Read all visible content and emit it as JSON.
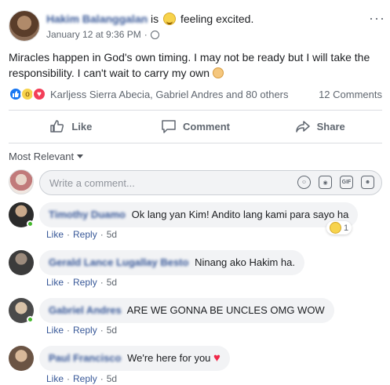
{
  "post": {
    "author": "Hakim Balanggalan",
    "verb": "is",
    "feeling": "feeling excited.",
    "timestamp": "January 12 at 9:36 PM",
    "dots": "···",
    "text": "Miracles happen in God's own timing. I may not be ready but I will take the responsibility. I can't wait to carry my own",
    "reaction_names": "Karljess Sierra Abecia, Gabriel Andres and 80 others",
    "comment_count": "12 Comments"
  },
  "actions": {
    "like": "Like",
    "comment": "Comment",
    "share": "Share"
  },
  "sort_label": "Most Relevant",
  "composer": {
    "placeholder": "Write a comment...",
    "gif": "GIF"
  },
  "comments": [
    {
      "name": "Timothy Duamo",
      "text": "Ok lang yan Kim! Andito lang kami para sayo ha",
      "like": "Like",
      "reply": "Reply",
      "time": "5d",
      "reaction_count": "1"
    },
    {
      "name": "Gerald Lance Lugallay Besto",
      "text": "Ninang ako Hakim ha.",
      "like": "Like",
      "reply": "Reply",
      "time": "5d"
    },
    {
      "name": "Gabriel Andres",
      "text": "ARE WE GONNA BE UNCLES OMG WOW",
      "like": "Like",
      "reply": "Reply",
      "time": "5d"
    },
    {
      "name": "Paul Francisco",
      "text": "We're here for you",
      "like": "Like",
      "reply": "Reply",
      "time": "5d"
    }
  ],
  "colors": {
    "link": "#385898",
    "secondary": "#606770",
    "bubble": "#f2f3f5",
    "like_blue": "#1877f2",
    "online": "#42b72a"
  }
}
